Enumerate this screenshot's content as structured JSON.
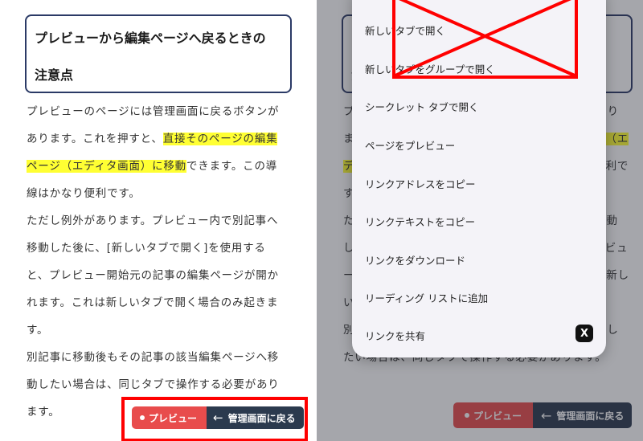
{
  "article": {
    "title_line1": "プレビューから編集ページへ戻るときの",
    "title_line2": "注意点",
    "p1_a": "プレビューのページには管理画面に戻るボタンがあります。これを押すと、",
    "p1_highlight": "直接そのページの編集ページ（エディタ画面）に移動",
    "p1_b": "できます。この導線はかなり便利です。",
    "p2": "ただし例外があります。プレビュー内で別記事へ移動した後に、[新しいタブで開く]を使用すると、プレビュー開始元の記事の編集ページが開かれます。これは新しいタブで開く場合のみ起きます。",
    "p3": "別記事に移動後もその記事の該当編集ページへ移動したい場合は、同じタブで操作する必要があります。"
  },
  "buttons": {
    "preview_label": "プレビュー",
    "admin_label": "管理画面に戻る",
    "arrow": "←"
  },
  "context_menu": {
    "items": [
      "新しいタブで開く",
      "新しいタブをグループで開く",
      "シークレット タブで開く",
      "ページをプレビュー",
      "リンクアドレスをコピー",
      "リンクテキストをコピー",
      "リンクをダウンロード",
      "リーディング リストに追加",
      "リンクを共有"
    ],
    "share_icon_glyph": "X"
  },
  "colors": {
    "highlight": "#ffff33",
    "preview_button": "#e84c4c",
    "admin_button": "#2b3a4e",
    "annotation_red": "#ff0000",
    "title_border": "#2b3a66"
  }
}
